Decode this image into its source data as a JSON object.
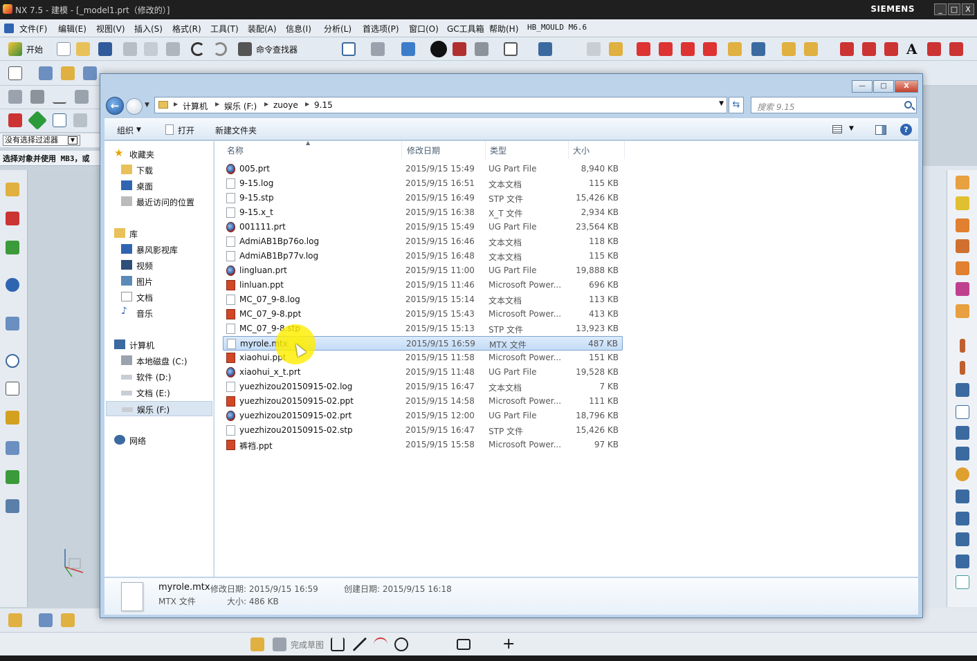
{
  "app": {
    "title": "NX 7.5 - 建模 - [_model1.prt（修改的）]",
    "brand": "SIEMENS",
    "window_buttons": [
      "_",
      "□",
      "X"
    ]
  },
  "menubar": {
    "items": [
      "文件(F)",
      "编辑(E)",
      "视图(V)",
      "插入(S)",
      "格式(R)",
      "工具(T)",
      "装配(A)",
      "信息(I)",
      "分析(L)",
      "首选项(P)",
      "窗口(O)",
      "GC工具箱",
      "帮助(H)",
      "HB_MOULD M6.6"
    ]
  },
  "toolbar": {
    "start_label": "开始",
    "command_finder_label": "命令查找器"
  },
  "selection": {
    "filter_value": "没有选择过滤器",
    "prompt": "选择对象并使用 MB3，或"
  },
  "sketch_toolbar": {
    "finish_label": "完成草图"
  },
  "dialog": {
    "caption_buttons": [
      "—",
      "□",
      "X"
    ],
    "breadcrumbs": [
      "计算机",
      "娱乐 (F:)",
      "zuoye",
      "9.15"
    ],
    "search_placeholder": "搜索 9.15",
    "commands": {
      "organize": "组织",
      "open": "打开",
      "new_folder": "新建文件夹"
    },
    "nav": {
      "favorites": "收藏夹",
      "favorites_items": [
        "下载",
        "桌面",
        "最近访问的位置"
      ],
      "libraries": "库",
      "libraries_items": [
        "暴风影视库",
        "视频",
        "图片",
        "文档",
        "音乐"
      ],
      "computer": "计算机",
      "computer_items": [
        "本地磁盘 (C:)",
        "软件 (D:)",
        "文档 (E:)",
        "娱乐 (F:)"
      ],
      "network": "网络"
    },
    "columns": [
      "名称",
      "修改日期",
      "类型",
      "大小"
    ],
    "files": [
      {
        "name": "005.prt",
        "date": "2015/9/15 15:49",
        "type": "UG Part File",
        "size": "8,940 KB",
        "icon": "ug-part-icon"
      },
      {
        "name": "9-15.log",
        "date": "2015/9/15 16:51",
        "type": "文本文档",
        "size": "115 KB",
        "icon": "text-file-icon"
      },
      {
        "name": "9-15.stp",
        "date": "2015/9/15 16:49",
        "type": "STP 文件",
        "size": "15,426 KB",
        "icon": "generic-file-icon"
      },
      {
        "name": "9-15.x_t",
        "date": "2015/9/15 16:38",
        "type": "X_T 文件",
        "size": "2,934 KB",
        "icon": "generic-file-icon"
      },
      {
        "name": "001111.prt",
        "date": "2015/9/15 15:49",
        "type": "UG Part File",
        "size": "23,564 KB",
        "icon": "ug-part-icon"
      },
      {
        "name": "AdmiAB1Bp76o.log",
        "date": "2015/9/15 16:46",
        "type": "文本文档",
        "size": "118 KB",
        "icon": "text-file-icon"
      },
      {
        "name": "AdmiAB1Bp77v.log",
        "date": "2015/9/15 16:48",
        "type": "文本文档",
        "size": "115 KB",
        "icon": "text-file-icon"
      },
      {
        "name": "lingluan.prt",
        "date": "2015/9/15 11:00",
        "type": "UG Part File",
        "size": "19,888 KB",
        "icon": "ug-part-icon"
      },
      {
        "name": "linluan.ppt",
        "date": "2015/9/15 11:46",
        "type": "Microsoft Power...",
        "size": "696 KB",
        "icon": "ppt-file-icon"
      },
      {
        "name": "MC_07_9-8.log",
        "date": "2015/9/15 15:14",
        "type": "文本文档",
        "size": "113 KB",
        "icon": "text-file-icon"
      },
      {
        "name": "MC_07_9-8.ppt",
        "date": "2015/9/15 15:43",
        "type": "Microsoft Power...",
        "size": "413 KB",
        "icon": "ppt-file-icon"
      },
      {
        "name": "MC_07_9-8.stp",
        "date": "2015/9/15 15:13",
        "type": "STP 文件",
        "size": "13,923 KB",
        "icon": "generic-file-icon"
      },
      {
        "name": "myrole.mtx",
        "date": "2015/9/15 16:59",
        "type": "MTX 文件",
        "size": "487 KB",
        "icon": "generic-file-icon",
        "selected": true
      },
      {
        "name": "xiaohui.ppt",
        "date": "2015/9/15 11:58",
        "type": "Microsoft Power...",
        "size": "151 KB",
        "icon": "ppt-file-icon"
      },
      {
        "name": "xiaohui_x_t.prt",
        "date": "2015/9/15 11:48",
        "type": "UG Part File",
        "size": "19,528 KB",
        "icon": "ug-part-icon"
      },
      {
        "name": "yuezhizou20150915-02.log",
        "date": "2015/9/15 16:47",
        "type": "文本文档",
        "size": "7 KB",
        "icon": "text-file-icon"
      },
      {
        "name": "yuezhizou20150915-02.ppt",
        "date": "2015/9/15 14:58",
        "type": "Microsoft Power...",
        "size": "111 KB",
        "icon": "ppt-file-icon"
      },
      {
        "name": "yuezhizou20150915-02.prt",
        "date": "2015/9/15 12:00",
        "type": "UG Part File",
        "size": "18,796 KB",
        "icon": "ug-part-icon"
      },
      {
        "name": "yuezhizou20150915-02.stp",
        "date": "2015/9/15 16:47",
        "type": "STP 文件",
        "size": "15,426 KB",
        "icon": "generic-file-icon"
      },
      {
        "name": "裤裆.ppt",
        "date": "2015/9/15 15:58",
        "type": "Microsoft Power...",
        "size": "97 KB",
        "icon": "ppt-file-icon"
      }
    ],
    "details": {
      "name": "myrole.mtx",
      "type": "MTX 文件",
      "modified": "修改日期: 2015/9/15 16:59",
      "created": "创建日期: 2015/9/15 16:18",
      "size": "大小: 486 KB"
    }
  },
  "colors": {
    "nx_titlebar": "#1f1f1f",
    "dialog_frame": "#bcd3ea",
    "selection": "#c4dcf7",
    "cursor_highlight": "#fff000"
  }
}
